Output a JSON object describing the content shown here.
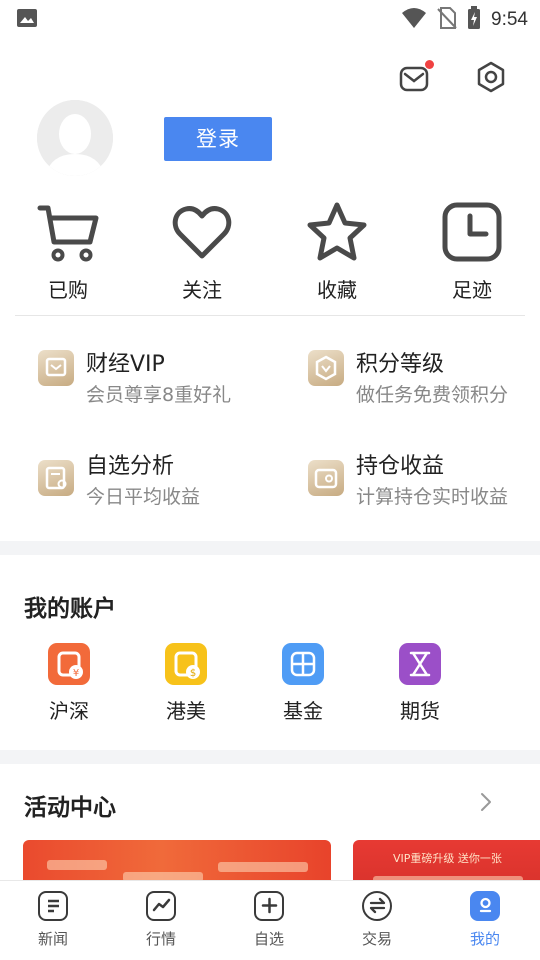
{
  "status_bar": {
    "time": "9:54"
  },
  "header": {
    "login_label": "登录"
  },
  "quick_actions": [
    {
      "label": "已购",
      "icon": "cart-icon"
    },
    {
      "label": "关注",
      "icon": "heart-icon"
    },
    {
      "label": "收藏",
      "icon": "star-icon"
    },
    {
      "label": "足迹",
      "icon": "clock-icon"
    }
  ],
  "features": [
    {
      "title": "财经VIP",
      "subtitle": "会员尊享8重好礼",
      "icon": "vip-card-icon"
    },
    {
      "title": "积分等级",
      "subtitle": "做任务免费领积分",
      "icon": "points-badge-icon"
    },
    {
      "title": "自选分析",
      "subtitle": "今日平均收益",
      "icon": "analysis-doc-icon"
    },
    {
      "title": "持仓收益",
      "subtitle": "计算持仓实时收益",
      "icon": "wallet-icon"
    }
  ],
  "accounts": {
    "title": "我的账户",
    "items": [
      {
        "label": "沪深",
        "icon": "hushen-icon",
        "color": "#f26a3a"
      },
      {
        "label": "港美",
        "icon": "gangmei-icon",
        "color": "#f7c21a"
      },
      {
        "label": "基金",
        "icon": "fund-grid-icon",
        "color": "#4f9cf5"
      },
      {
        "label": "期货",
        "icon": "hourglass-icon",
        "color": "#9b4fc8"
      }
    ]
  },
  "activity": {
    "title": "活动中心",
    "banner2_text": "VIP重磅升级 送你一张"
  },
  "tabs": [
    {
      "label": "新闻",
      "icon": "news-icon",
      "active": false
    },
    {
      "label": "行情",
      "icon": "market-chart-icon",
      "active": false
    },
    {
      "label": "自选",
      "icon": "add-watchlist-icon",
      "active": false
    },
    {
      "label": "交易",
      "icon": "trade-icon",
      "active": false
    },
    {
      "label": "我的",
      "icon": "profile-icon",
      "active": true
    }
  ],
  "colors": {
    "accent": "#4a87f0",
    "badge": "#f04141",
    "gold": "#c7ab82"
  }
}
